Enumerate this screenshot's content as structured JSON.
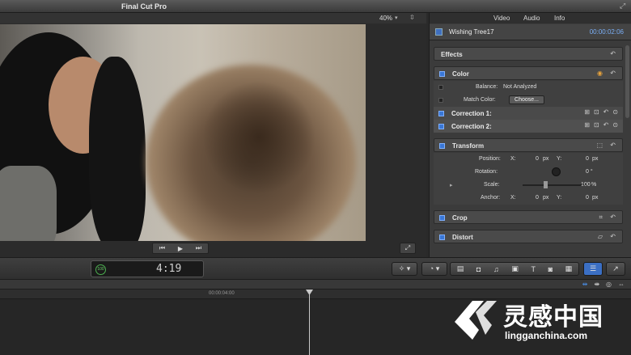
{
  "app": {
    "title": "Final Cut Pro"
  },
  "viewer": {
    "zoom": "40%",
    "transport": {
      "prev": "⏮",
      "play": "▶",
      "next": "⏭"
    },
    "fullscreen_glyph": "⤢"
  },
  "inspector": {
    "tabs": [
      "Video",
      "Audio",
      "Info"
    ],
    "clip_name": "Wishing Tree17",
    "clip_timecode": "00:00:02:06",
    "effects": {
      "label": "Effects"
    },
    "color": {
      "label": "Color",
      "balance_label": "Balance:",
      "balance_value": "Not Analyzed",
      "match_label": "Match Color:",
      "choose_label": "Choose...",
      "corrections": [
        "Correction 1:",
        "Correction 2:"
      ]
    },
    "transform": {
      "label": "Transform",
      "position_label": "Position:",
      "x_label": "X:",
      "y_label": "Y:",
      "pos_x": "0",
      "pos_y": "0",
      "unit_px": "px",
      "rotation_label": "Rotation:",
      "rotation_value": "0 °",
      "scale_label": "Scale:",
      "scale_value": "100",
      "scale_unit": "%",
      "anchor_label": "Anchor:",
      "anchor_x": "0",
      "anchor_y": "0"
    },
    "crop": {
      "label": "Crop"
    },
    "distort": {
      "label": "Distort"
    }
  },
  "toolbar": {
    "timecode_badge": "100",
    "timecode": "4:19"
  },
  "timeline": {
    "ruler_time": "00:00:04:00"
  },
  "watermark": {
    "cn": "灵感中国",
    "en": "lingganchina.com"
  }
}
